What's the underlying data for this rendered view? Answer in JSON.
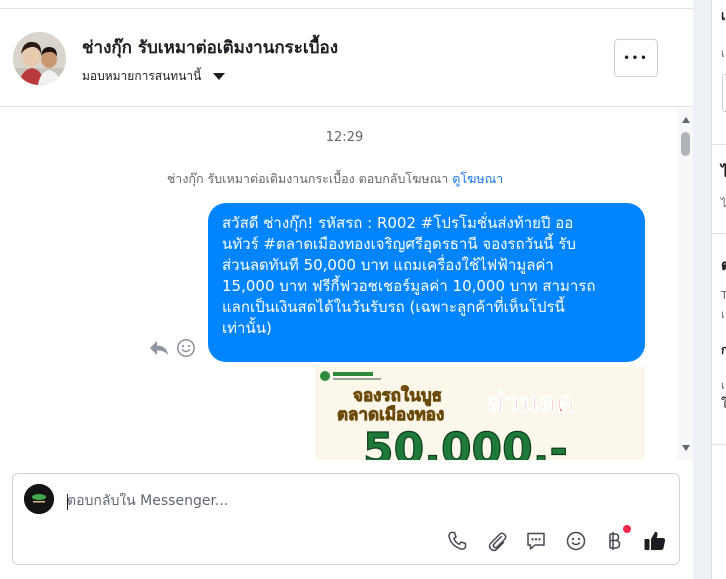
{
  "header": {
    "page_name": "ช่างกุ๊ก รับเหมาต่อเติมงานกระเบื้อง",
    "assign_label": "มอบหมายการสนทนานี้",
    "more_label": "•••"
  },
  "messages": {
    "timestamp": "12:29",
    "ad_reply_text": "ช่างกุ๊ก รับเหมาต่อเติมงานกระเบื้อง ตอบกลับโฆษณา",
    "ad_link": "ดูโฆษณา",
    "bubble_lines": [
      "สวัสดี ช่างกุ๊ก! รหัสรถ : R002 #โปรโมชั่นส่งท้ายปี ออ",
      "นทัวร์ #ตลาดเมืองทองเจริญศรีอุดรธานี จองรถวันนี้ รับ",
      "ส่วนลดทันที 50,000 บาท แถมเครื่องใช้ไฟฟ้ามูลค่า",
      "15,000 บาท ฟรีกี้ฟวอชเชอร์มูลค่า 10,000 บาท สามารถ",
      "แลกเป็นเงินสดได้ในวันรับรถ (เฉพาะลูกค้าที่เห็นโปรนี้",
      "เท่านั้น)"
    ],
    "promo_image": {
      "line1": "จองรถในบูธ",
      "line2": "ตลาดเมืองทอง",
      "highlight": "ส่วนลด",
      "amount": "50,000.-"
    }
  },
  "composer": {
    "placeholder": "ตอบกลับใน Messenger..."
  },
  "right_panel": {
    "letters": [
      "เ",
      "เ",
      "ไ",
      "ไ",
      "ต",
      "T",
      "เ",
      "ก",
      "เ",
      "ใ"
    ]
  },
  "colors": {
    "bubble": "#0084ff",
    "link": "#1877f2",
    "badge": "#f02849",
    "divider": "#dddfe2"
  }
}
